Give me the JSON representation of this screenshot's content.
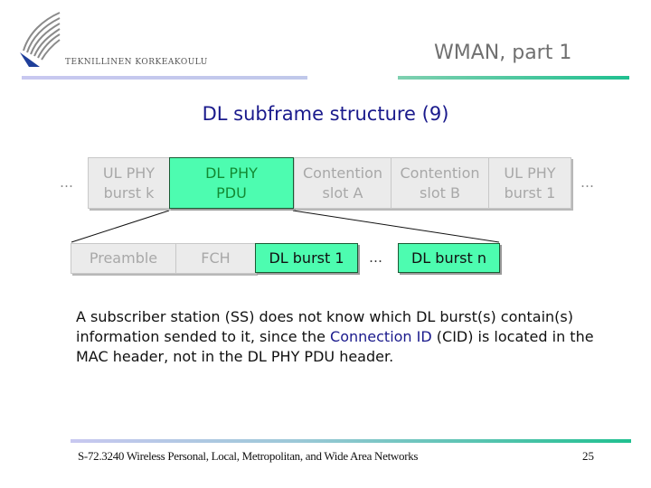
{
  "header": {
    "school_name": "TEKNILLINEN KORKEAKOULU",
    "title": "WMAN, part 1"
  },
  "slide": {
    "title": "DL subframe structure (9)"
  },
  "diagram": {
    "top_row": {
      "leading_ellipsis": "…",
      "trailing_ellipsis": "…",
      "cells": [
        {
          "line1": "UL PHY",
          "line2": "burst k",
          "style": "gray"
        },
        {
          "line1": "DL PHY",
          "line2": "PDU",
          "style": "green"
        },
        {
          "line1": "Contention",
          "line2": "slot A",
          "style": "gray"
        },
        {
          "line1": "Contention",
          "line2": "slot B",
          "style": "gray"
        },
        {
          "line1": "UL PHY",
          "line2": "burst 1",
          "style": "gray"
        }
      ]
    },
    "bottom_row": {
      "cells": [
        {
          "label": "Preamble",
          "style": "gray"
        },
        {
          "label": "FCH",
          "style": "gray"
        },
        {
          "label": "DL burst 1",
          "style": "green"
        },
        {
          "label": "DL burst n",
          "style": "green"
        }
      ],
      "middle_ellipsis": "…"
    },
    "colors": {
      "highlight_fill": "#4dfcb0",
      "highlight_text": "#138a33",
      "gray_fill": "#ebebeb",
      "gray_text": "#a8a8a8"
    }
  },
  "body": {
    "part1": "A subscriber station (SS) does not know which DL burst(s) contain(s) information sended to it, since the ",
    "highlight": "Connection ID",
    "part2": " (CID) is located in the MAC header, not in the DL PHY PDU header."
  },
  "footer": {
    "course": "S-72.3240 Wireless Personal, Local, Metropolitan, and Wide Area Networks",
    "page_number": "25"
  }
}
